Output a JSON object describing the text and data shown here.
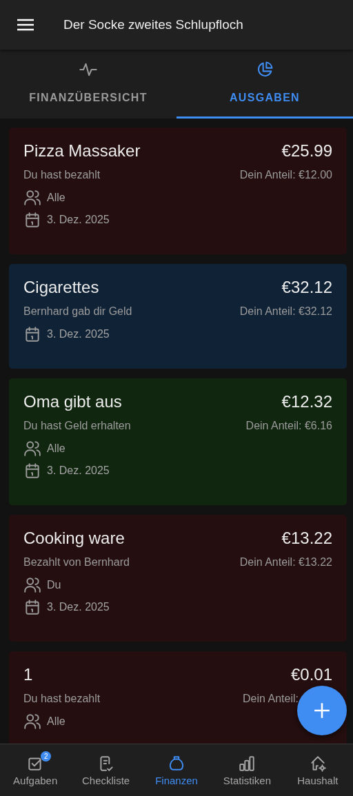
{
  "app_bar": {
    "title": "Der Socke zweites Schlupfloch"
  },
  "tabs": [
    {
      "label": "FINANZÜBERSICHT",
      "selected": false
    },
    {
      "label": "AUSGABEN",
      "selected": true
    }
  ],
  "expenses": [
    {
      "title": "Pizza Massaker",
      "amount": "€25.99",
      "payer": "Du hast bezahlt",
      "share": "Dein Anteil: €12.00",
      "people": "Alle",
      "date": "3. Dez. 2025",
      "color": "#240e0f"
    },
    {
      "title": "Cigarettes",
      "amount": "€32.12",
      "payer": "Bernhard gab dir Geld",
      "share": "Dein Anteil: €32.12",
      "date": "3. Dez. 2025",
      "color": "#0f2236"
    },
    {
      "title": "Oma gibt aus",
      "amount": "€12.32",
      "payer": "Du hast Geld erhalten",
      "share": "Dein Anteil: €6.16",
      "people": "Alle",
      "date": "3. Dez. 2025",
      "color": "#10260f"
    },
    {
      "title": "Cooking ware",
      "amount": "€13.22",
      "payer": "Bezahlt von Bernhard",
      "share": "Dein Anteil: €13.22",
      "people": "Du",
      "date": "3. Dez. 2025",
      "color": "#240e0f"
    },
    {
      "title": "1",
      "amount": "€0.01",
      "payer": "Du hast bezahlt",
      "share": "Dein Anteil:",
      "people": "Alle",
      "color": "#240e0f"
    }
  ],
  "bottom_nav": [
    {
      "label": "Aufgaben",
      "selected": false,
      "badge": "2"
    },
    {
      "label": "Checkliste",
      "selected": false
    },
    {
      "label": "Finanzen",
      "selected": true
    },
    {
      "label": "Statistiken",
      "selected": false
    },
    {
      "label": "Haushalt",
      "selected": false
    }
  ]
}
